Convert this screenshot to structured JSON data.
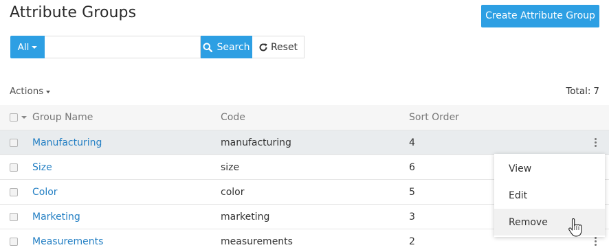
{
  "header": {
    "title": "Attribute Groups",
    "create_button_label": "Create Attribute Group"
  },
  "search": {
    "scope_label": "All",
    "value": "",
    "placeholder": "",
    "search_label": "Search",
    "reset_label": "Reset"
  },
  "toolbar": {
    "actions_label": "Actions",
    "total_label": "Total:",
    "total_count": "7"
  },
  "table": {
    "columns": {
      "name": "Group Name",
      "code": "Code",
      "sort": "Sort Order"
    },
    "rows": [
      {
        "name": "Manufacturing",
        "code": "manufacturing",
        "sort": "4"
      },
      {
        "name": "Size",
        "code": "size",
        "sort": "6"
      },
      {
        "name": "Color",
        "code": "color",
        "sort": "5"
      },
      {
        "name": "Marketing",
        "code": "marketing",
        "sort": "3"
      },
      {
        "name": "Measurements",
        "code": "measurements",
        "sort": "2"
      }
    ]
  },
  "context_menu": {
    "items": [
      "View",
      "Edit",
      "Remove"
    ],
    "hovered": "Remove"
  },
  "colors": {
    "primary": "#2d9fe3",
    "link": "#2580c4",
    "row_highlight": "#e9ecee"
  },
  "icons": {
    "search": "search-icon",
    "reset": "refresh-icon",
    "row_actions": "kebab-icon",
    "cursor": "hand-pointer-icon"
  }
}
